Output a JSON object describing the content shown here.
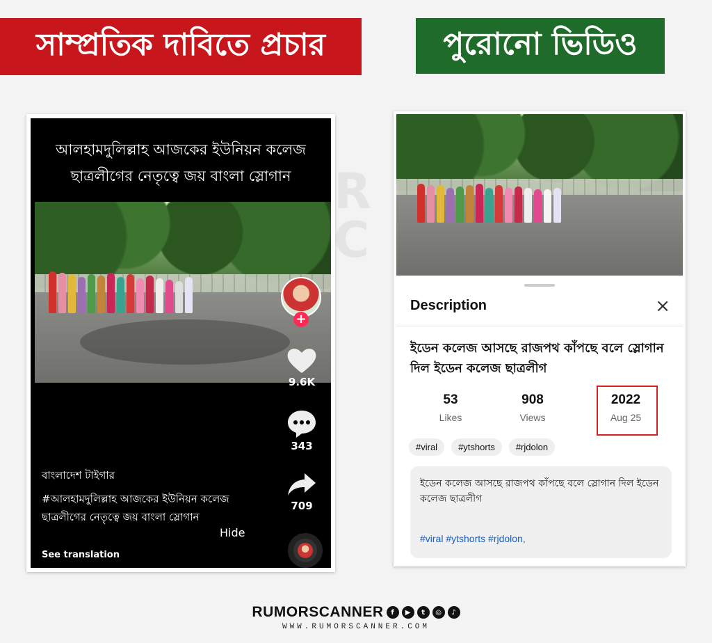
{
  "banners": {
    "left": "সাম্প্রতিক দাবিতে প্রচার",
    "right": "পুরোনো ভিডিও"
  },
  "tiktok": {
    "caption_line1": "আলহামদুলিল্লাহ আজকের ইউনিয়ন কলেজ",
    "caption_line2": "ছাত্রলীগের নেতৃত্বে জয় বাংলা স্লোগান",
    "follow_label": "+",
    "likes": "9.6K",
    "comments": "343",
    "shares": "709",
    "author": "বাংলাদেশ টাইগার",
    "description": "#আলহামদুলিল্লাহ আজকের ইউনিয়ন কলেজ ছাত্রলীগের নেতৃত্বে জয় বাংলা স্লোগান",
    "hide_label": "Hide",
    "translate_label": "See translation"
  },
  "youtube": {
    "sheet_title": "Description",
    "close_icon": "×",
    "video_title": "ইডেন কলেজ আসছে রাজপথ কাঁপছে বলে স্লোগান দিল ইডেন কলেজ ছাত্রলীগ",
    "stats": {
      "likes_value": "53",
      "likes_label": "Likes",
      "views_value": "908",
      "views_label": "Views",
      "year": "2022",
      "date": "Aug 25"
    },
    "tags": [
      "#viral",
      "#ytshorts",
      "#rjdolon"
    ],
    "description_text": "ইডেন কলেজ আসছে রাজপথ কাঁপছে বলে স্লোগান দিল ইডেন কলেজ ছাত্রলীগ",
    "description_hashtags": "#viral #ytshorts #rjdolon,"
  },
  "footer": {
    "brand": "RUMORSCANNER",
    "url": "WWW.RUMORSCANNER.COM",
    "social_icons": [
      "facebook-icon",
      "youtube-icon",
      "twitter-icon",
      "instagram-icon",
      "tiktok-icon"
    ]
  },
  "colors": {
    "claim_red": "#c7161c",
    "old_green": "#1f6b2a",
    "tiktok_pink": "#fe2c55",
    "highlight_red": "#d42222",
    "link_blue": "#1a5fc6"
  }
}
